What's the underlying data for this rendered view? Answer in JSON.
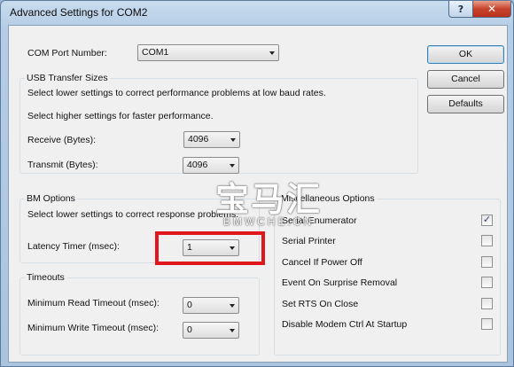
{
  "window": {
    "title": "Advanced Settings for COM2",
    "help": "?",
    "close": "✕"
  },
  "com_port": {
    "label": "COM Port Number:",
    "value": "COM1"
  },
  "usb": {
    "title": "USB Transfer Sizes",
    "line1": "Select lower settings to correct performance problems at low baud rates.",
    "line2": "Select higher settings for faster performance.",
    "receive_label": "Receive (Bytes):",
    "receive_value": "4096",
    "transmit_label": "Transmit (Bytes):",
    "transmit_value": "4096"
  },
  "bm": {
    "title": "BM Options",
    "desc": "Select lower settings to correct response problems.",
    "latency_label": "Latency Timer (msec):",
    "latency_value": "1"
  },
  "timeouts": {
    "title": "Timeouts",
    "read_label": "Minimum Read Timeout (msec):",
    "read_value": "0",
    "write_label": "Minimum Write Timeout (msec):",
    "write_value": "0"
  },
  "misc": {
    "title": "Miscellaneous Options",
    "options": [
      {
        "label": "Serial Enumerator",
        "checked": true
      },
      {
        "label": "Serial Printer",
        "checked": false
      },
      {
        "label": "Cancel If Power Off",
        "checked": false
      },
      {
        "label": "Event On Surprise Removal",
        "checked": false
      },
      {
        "label": "Set RTS On Close",
        "checked": false
      },
      {
        "label": "Disable Modem Ctrl At Startup",
        "checked": false
      }
    ]
  },
  "buttons": {
    "ok": "OK",
    "cancel": "Cancel",
    "defaults": "Defaults"
  },
  "watermark": {
    "main": "宝马汇",
    "sub": "BMWCHE.CN"
  },
  "colors": {
    "highlight": "#e0161e",
    "accent": "#3c7fb1"
  },
  "icons": {
    "help": "question-icon",
    "close": "close-icon",
    "check": "checkmark-icon"
  }
}
